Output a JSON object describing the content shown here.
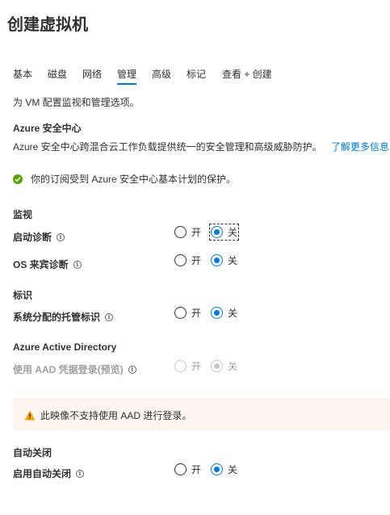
{
  "page": {
    "title": "创建虚拟机"
  },
  "tabs": [
    {
      "label": "基本"
    },
    {
      "label": "磁盘"
    },
    {
      "label": "网络"
    },
    {
      "label": "管理"
    },
    {
      "label": "高级"
    },
    {
      "label": "标记"
    },
    {
      "label": "查看 + 创建"
    }
  ],
  "active_tab": "管理",
  "description": "为 VM 配置监视和管理选项。",
  "security_center": {
    "heading": "Azure 安全中心",
    "text": "Azure 安全中心跨混合云工作负载提供统一的安全管理和高级威胁防护。",
    "link": "了解更多信息",
    "status": "你的订阅受到 Azure 安全中心基本计划的保护。",
    "status_icon": "check-circle-icon",
    "status_color": "#57a300"
  },
  "monitoring": {
    "heading": "监视",
    "boot_diagnostics": {
      "label": "启动诊断",
      "on": "开",
      "off": "关",
      "selected": "关"
    },
    "guest_os_diagnostics": {
      "label": "OS 来宾诊断",
      "on": "开",
      "off": "关",
      "selected": "关"
    }
  },
  "identity": {
    "heading": "标识",
    "system_assigned": {
      "label": "系统分配的托管标识",
      "on": "开",
      "off": "关",
      "selected": "关"
    }
  },
  "aad": {
    "heading": "Azure Active Directory",
    "login": {
      "label": "使用 AAD 凭据登录(预览)",
      "on": "开",
      "off": "关",
      "selected": "关",
      "disabled": true
    }
  },
  "warning": {
    "text": "此映像不支持使用 AAD 进行登录。",
    "icon": "warning-icon",
    "color": "#f7a600"
  },
  "auto_shutdown": {
    "heading": "自动关闭",
    "enable": {
      "label": "启用自动关闭",
      "on": "开",
      "off": "关",
      "selected": "关"
    }
  },
  "colors": {
    "accent": "#0078d4"
  }
}
